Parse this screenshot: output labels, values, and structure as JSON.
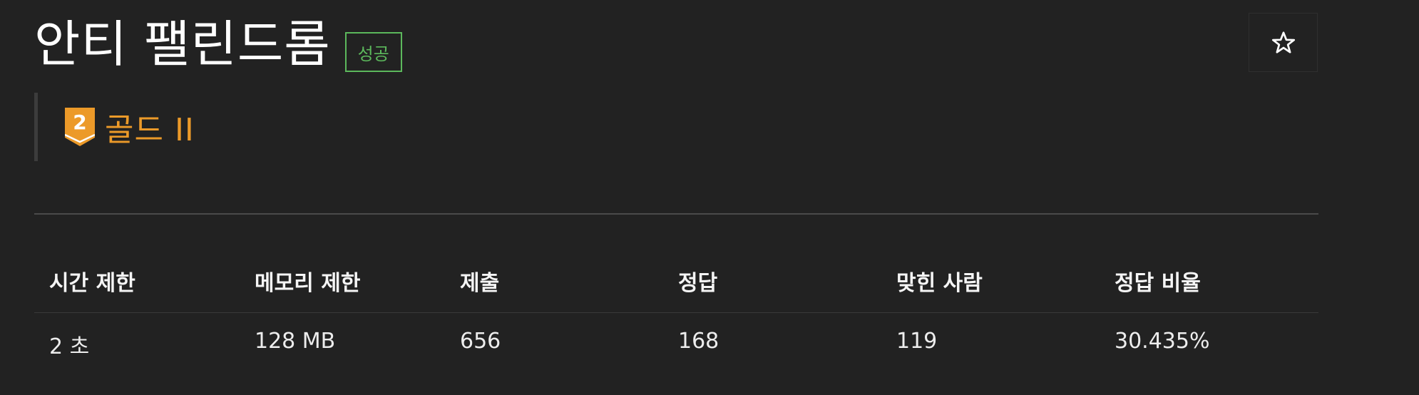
{
  "problem": {
    "title": "안티 팰린드롬",
    "status_badge": "성공"
  },
  "tier": {
    "number": "2",
    "label": "골드 II",
    "color": "#ec9a29"
  },
  "favorite": {
    "icon": "star-outline-icon",
    "glyph": "☆"
  },
  "info_table": {
    "headers": [
      "시간 제한",
      "메모리 제한",
      "제출",
      "정답",
      "맞힌 사람",
      "정답 비율"
    ],
    "values": [
      "2 초",
      "128 MB",
      "656",
      "168",
      "119",
      "30.435%"
    ]
  },
  "colors": {
    "background": "#222222",
    "success": "#5cb85c",
    "gold": "#ec9a29"
  }
}
